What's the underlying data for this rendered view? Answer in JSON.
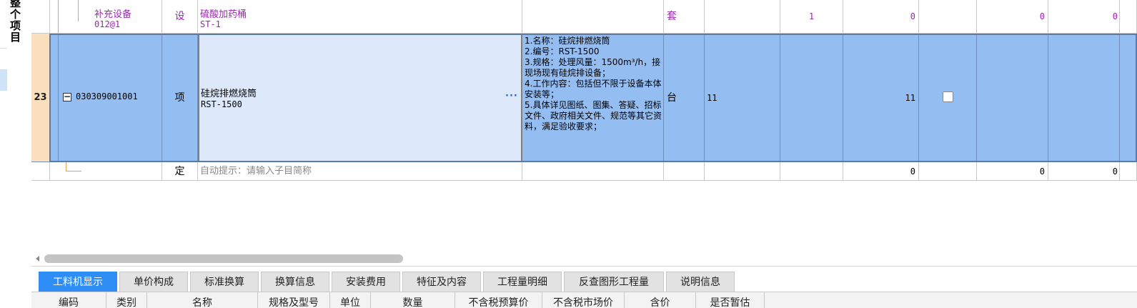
{
  "sidebar": {
    "vertical_label": "整个项目"
  },
  "grid": {
    "rows": {
      "equip": {
        "name": "补充设备",
        "code": "012@1",
        "type": "设",
        "desc_name": "硫酸加药桶",
        "desc_spec": "ST-1",
        "unit": "套",
        "qty": "1",
        "v1": "0",
        "v2": "0",
        "v3": "0"
      },
      "main": {
        "row_number": "23",
        "expand": "−",
        "code": "030309001001",
        "type": "项",
        "name": "硅烷排燃烧筒",
        "spec": "RST-1500",
        "ellipsis": "···",
        "features": [
          "1.名称：硅烷排燃烧筒",
          "2.编号：RST-1500",
          "3.规格：处理风量：1500m³/h，接现场现有硅烷排设备；",
          "4.工作内容：包括但不限于设备本体安装等；",
          "5.具体详见图纸、图集、答疑、招标文件、政府相关文件、规范等其它资料，满足验收要求；"
        ],
        "unit": "台",
        "qty": "11",
        "amount": "11"
      },
      "hint": {
        "type": "定",
        "placeholder": "自动提示：请输入子目简称",
        "v1": "0",
        "v2": "0",
        "v3": "0"
      }
    }
  },
  "tabs": [
    {
      "label": "工料机显示",
      "active": true
    },
    {
      "label": "单价构成"
    },
    {
      "label": "标准换算"
    },
    {
      "label": "换算信息"
    },
    {
      "label": "安装费用"
    },
    {
      "label": "特征及内容"
    },
    {
      "label": "工程量明细"
    },
    {
      "label": "反查图形工程量"
    },
    {
      "label": "说明信息"
    }
  ],
  "bottom_headers": [
    "编码",
    "类别",
    "名称",
    "规格及型号",
    "单位",
    "数量",
    "不含税预算价",
    "不含税市场价",
    "含价",
    "是否暂估"
  ],
  "colors": {
    "selected_row": "#94bdf2",
    "active_tab": "#2e8ef5",
    "equipment_text": "#9b27b0"
  }
}
